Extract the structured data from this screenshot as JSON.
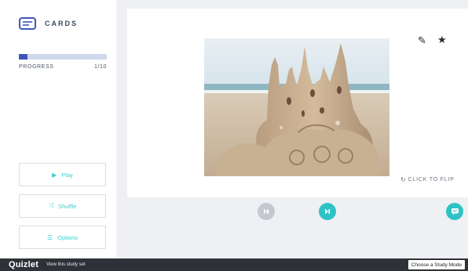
{
  "sidebar": {
    "mode_title": "CARDS",
    "progress": {
      "label": "PROGRESS",
      "count": "1/10",
      "fraction": 0.1
    },
    "buttons": {
      "play": {
        "glyph": "▶",
        "label": "Play"
      },
      "shuffle": {
        "glyph": "⤨",
        "label": "Shuffle"
      },
      "options": {
        "glyph": "☰",
        "label": "Options"
      }
    }
  },
  "card": {
    "edit_icon": "✎",
    "star_icon": "★",
    "flip": {
      "glyph": "↻",
      "label": "CLICK TO FLIP"
    }
  },
  "colors": {
    "accent": "#2ec2c5",
    "progress": "#3f56b8",
    "footer": "#2e3238"
  },
  "footer": {
    "brand": "Quizlet",
    "view_link": "View this study set",
    "mode_button": "Choose a Study Mode"
  }
}
